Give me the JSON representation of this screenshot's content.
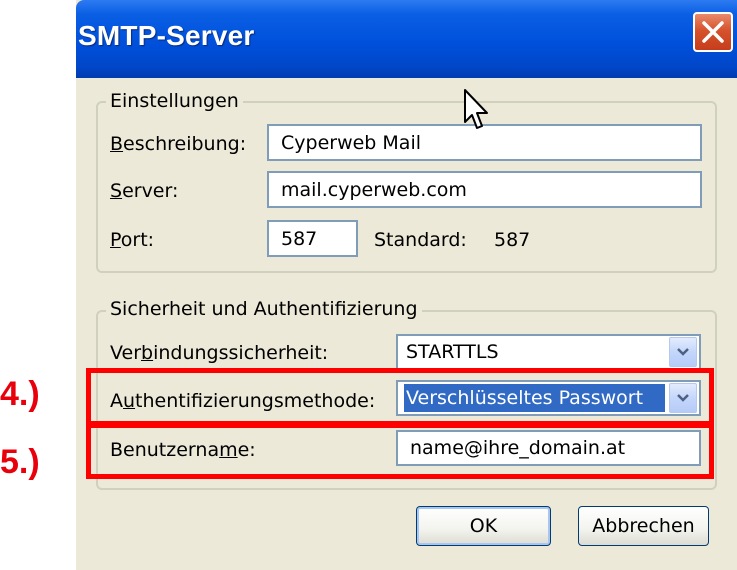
{
  "window": {
    "title": "SMTP-Server"
  },
  "settings": {
    "legend": "Einstellungen",
    "description": {
      "label_ul": "B",
      "label_rest": "eschreibung:",
      "value": "Cyperweb Mail"
    },
    "server": {
      "label_ul": "S",
      "label_rest": "erver:",
      "value": "mail.cyperweb.com"
    },
    "port": {
      "label_ul": "P",
      "label_rest": "ort:",
      "value": "587",
      "default_label": "Standard:",
      "default_value": "587"
    }
  },
  "security": {
    "legend": "Sicherheit und Authentifizierung",
    "connection": {
      "label_pre": "Ver",
      "label_ul": "b",
      "label_rest": "indungssicherheit:",
      "value": "STARTTLS"
    },
    "auth": {
      "label_pre": "A",
      "label_ul": "u",
      "label_rest": "thentifizierungsmethode:",
      "value": "Verschlüsseltes Passwort"
    },
    "username": {
      "label_pre": "Benutzerna",
      "label_ul": "m",
      "label_rest": "e:",
      "value": "name@ihre_domain.at"
    }
  },
  "steps": {
    "step4": "4.)",
    "step5": "5.)"
  },
  "buttons": {
    "ok": "OK",
    "cancel": "Abbrechen"
  },
  "colors": {
    "title_bar": "#0050dc",
    "highlight": "#316ac5",
    "annotation": "#ff0000",
    "dialog_bg": "#ece9d8"
  },
  "icons": {
    "close": "close-icon",
    "dropdown": "chevron-down-icon",
    "cursor": "mouse-pointer-icon"
  }
}
